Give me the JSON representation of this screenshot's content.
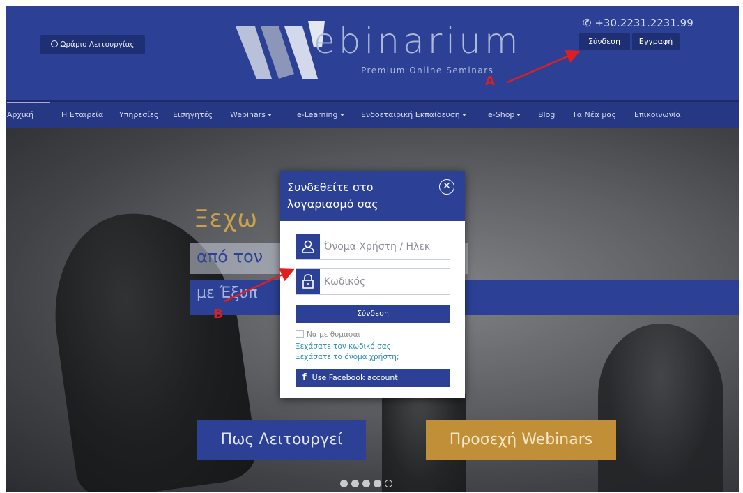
{
  "header": {
    "hours_button": "Ωράριο Λειτουργίας",
    "logo_word": "ebinarium",
    "logo_tagline": "Premium Online Seminars",
    "phone": "+30.2231.2231.99",
    "login_button": "Σύνδεση",
    "register_button": "Εγγραφή"
  },
  "nav": {
    "items": [
      {
        "label": "Αρχική"
      },
      {
        "label": "Η Εταιρεία"
      },
      {
        "label": "Υπηρεσίες"
      },
      {
        "label": "Εισηγητές"
      },
      {
        "label": "Webinars"
      },
      {
        "label": "e-Learning"
      },
      {
        "label": "Ενδοεταιρική Εκπαίδευση"
      },
      {
        "label": "e-Shop"
      },
      {
        "label": "Blog"
      },
      {
        "label": "Τα Νέα μας"
      },
      {
        "label": "Επικοινωνία"
      }
    ]
  },
  "hero": {
    "title": "Ξεχω",
    "line2": "από τον",
    "line3": "με Έξυπ",
    "cta_how": "Πως Λειτουργεί",
    "cta_webinars": "Προσεχή Webinars",
    "slide_count": 5,
    "active_slide": 5
  },
  "modal": {
    "title": "Συνδεθείτε στο λογαριασμό σας",
    "username_placeholder": "Όνομα Χρήστη / Ηλεκ",
    "password_placeholder": "Κωδικός",
    "submit": "Σύνδεση",
    "remember": "Να με θυμάσαι",
    "forgot_password": "Ξεχάσατε τον κωδικό σας;",
    "forgot_username": "Ξεχάσατε το όνομα χρήστη;",
    "facebook": "Use Facebook account"
  },
  "annotations": {
    "label_a": "A",
    "label_b": "B",
    "color": "#e01e1e"
  },
  "colors": {
    "brand_blue": "#2c4196",
    "accent_gold": "#c08f37",
    "link": "#2c8fb0"
  }
}
